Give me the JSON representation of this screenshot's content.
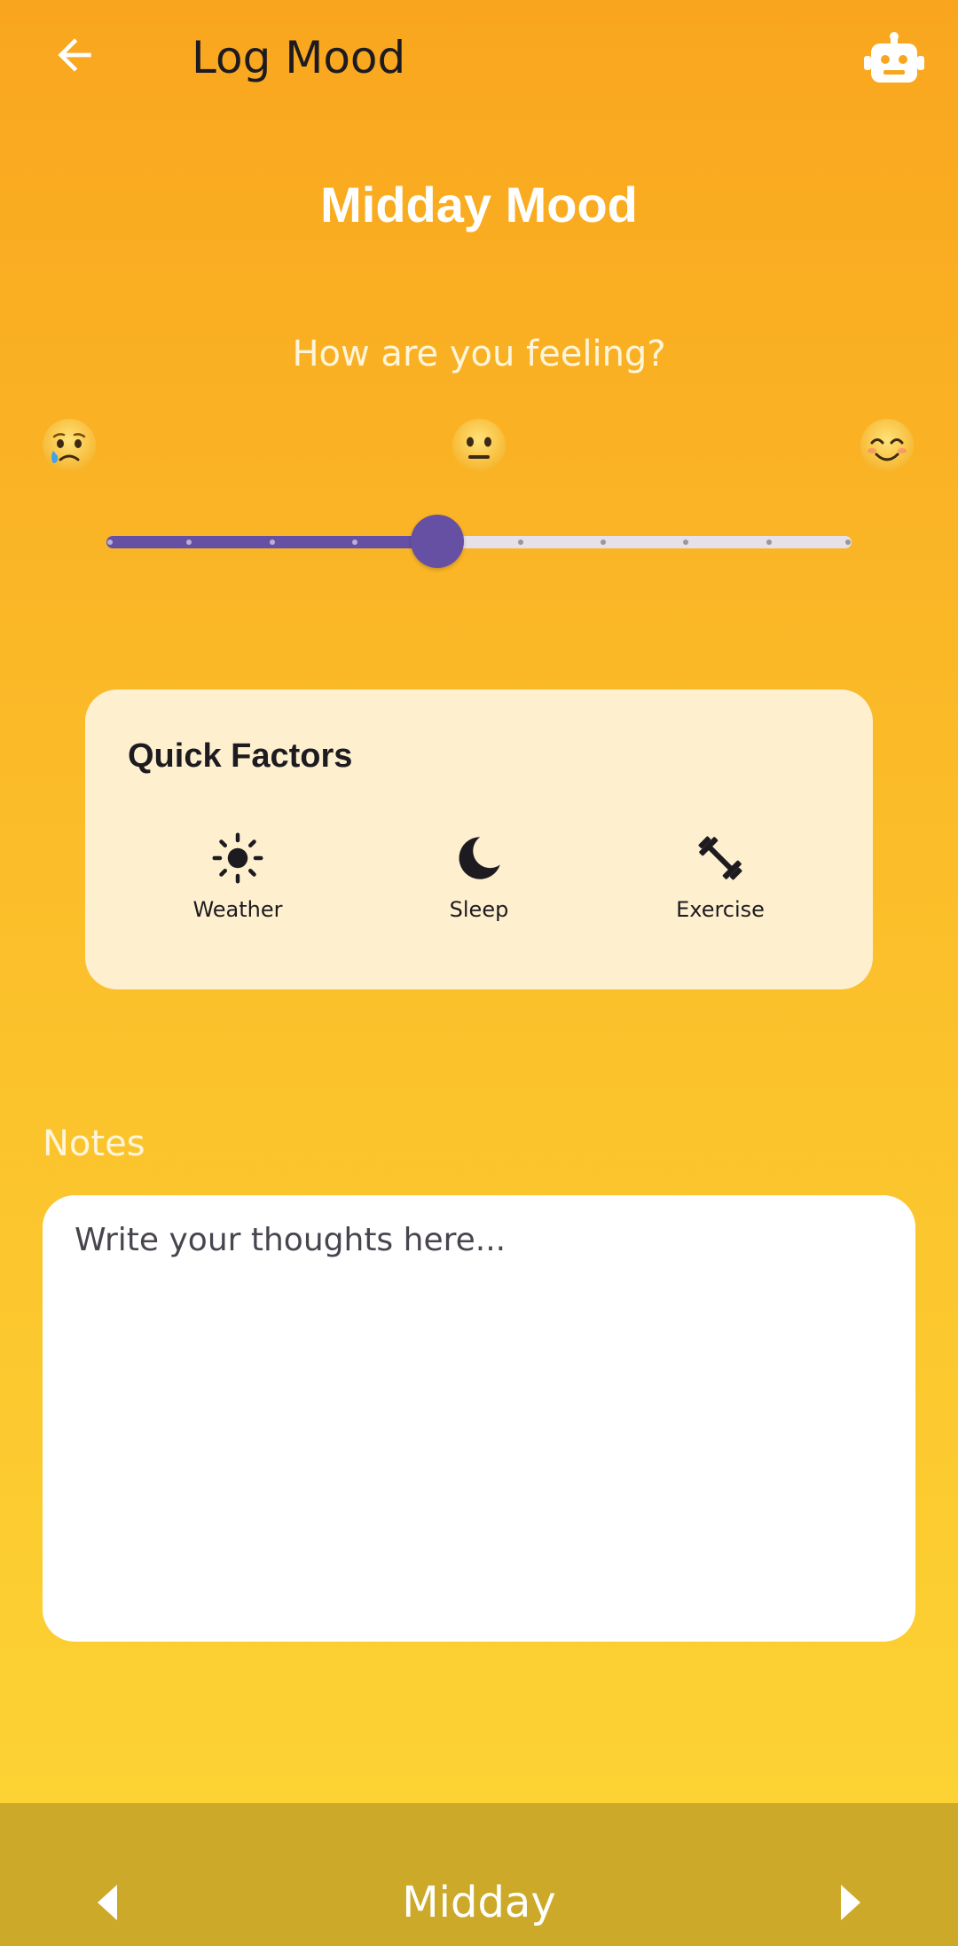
{
  "appbar": {
    "title": "Log Mood",
    "back_icon": "arrow-left-icon",
    "assistant_icon": "robot-icon"
  },
  "mood": {
    "title": "Midday Mood",
    "prompt": "How are you feeling?",
    "emojis": [
      "crying-face-icon",
      "neutral-face-icon",
      "smiling-face-icon"
    ],
    "slider": {
      "min": 0,
      "max": 9,
      "value": 4,
      "divisions": 9
    }
  },
  "factors": {
    "title": "Quick Factors",
    "items": [
      {
        "label": "Weather",
        "icon": "sun-icon"
      },
      {
        "label": "Sleep",
        "icon": "moon-icon"
      },
      {
        "label": "Exercise",
        "icon": "dumbbell-icon"
      }
    ]
  },
  "notes": {
    "label": "Notes",
    "placeholder": "Write your thoughts here...",
    "value": ""
  },
  "bottom_bar": {
    "period": "Midday",
    "prev_icon": "caret-left-icon",
    "next_icon": "caret-right-icon"
  },
  "colors": {
    "gradient_top": "#F9A61E",
    "gradient_bottom": "#FCD535",
    "accent": "#6650A4",
    "track_inactive": "#E6E0E9",
    "card_bg": "#FEF0CF",
    "bottom_bar": "#CCA928"
  }
}
